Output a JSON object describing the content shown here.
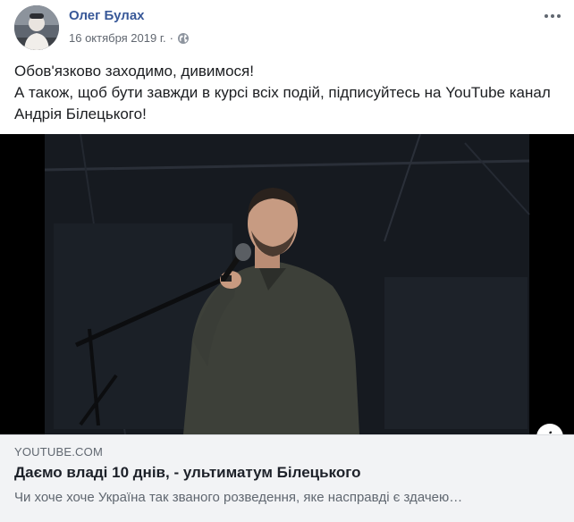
{
  "post": {
    "author": "Олег Булах",
    "date": "16 октября 2019 г.",
    "separator": "·",
    "privacy_icon": "globe-icon",
    "more_icon": "more-horizontal-icon",
    "text_lines": [
      "Обов'язково заходимо, дивимося!",
      "А також, щоб бути завжди в курсі всіх подій, підписуйтесь на YouTube канал",
      "Андрія Білецького!"
    ]
  },
  "link_preview": {
    "domain": "YOUTUBE.COM",
    "title": "Даємо владі 10 днів, - ультиматум Білецького",
    "description": "Чи хоче хоче Україна так званого розведення, яке насправді є здачею…",
    "info_label": "i"
  },
  "colors": {
    "author_link": "#385898",
    "meta_text": "#616770",
    "body_text": "#1c1e21",
    "preview_bg": "#f2f3f5"
  }
}
